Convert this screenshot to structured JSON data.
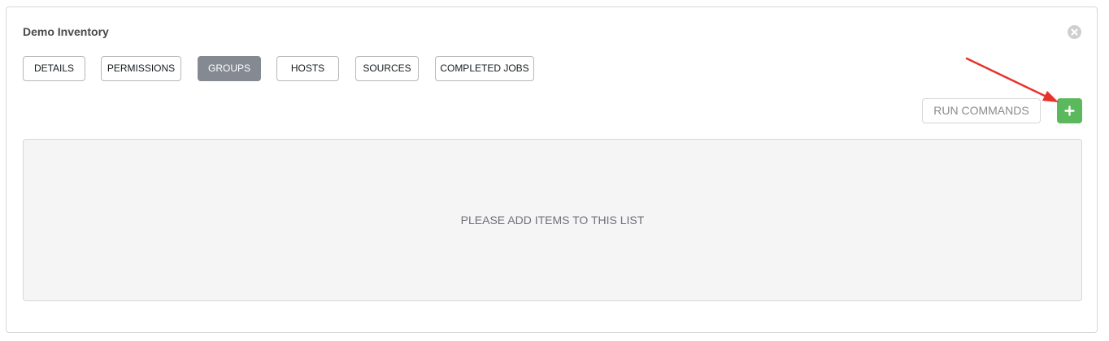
{
  "panel": {
    "title": "Demo Inventory"
  },
  "tabs": [
    {
      "label": "DETAILS",
      "active": false
    },
    {
      "label": "PERMISSIONS",
      "active": false
    },
    {
      "label": "GROUPS",
      "active": true
    },
    {
      "label": "HOSTS",
      "active": false
    },
    {
      "label": "SOURCES",
      "active": false
    },
    {
      "label": "COMPLETED JOBS",
      "active": false
    }
  ],
  "actions": {
    "run_commands_label": "RUN COMMANDS",
    "run_commands_enabled": false,
    "add_icon": "plus-icon",
    "close_icon": "close-icon"
  },
  "list": {
    "empty_message": "PLEASE ADD ITEMS TO THIS LIST"
  },
  "annotation": {
    "type": "arrow",
    "color": "#e8322c",
    "points_to": "add-button"
  },
  "colors": {
    "active_tab": "#848992",
    "add_button": "#5cb85c",
    "close_button": "#cfcfcf",
    "empty_list_bg": "#f5f5f5"
  }
}
